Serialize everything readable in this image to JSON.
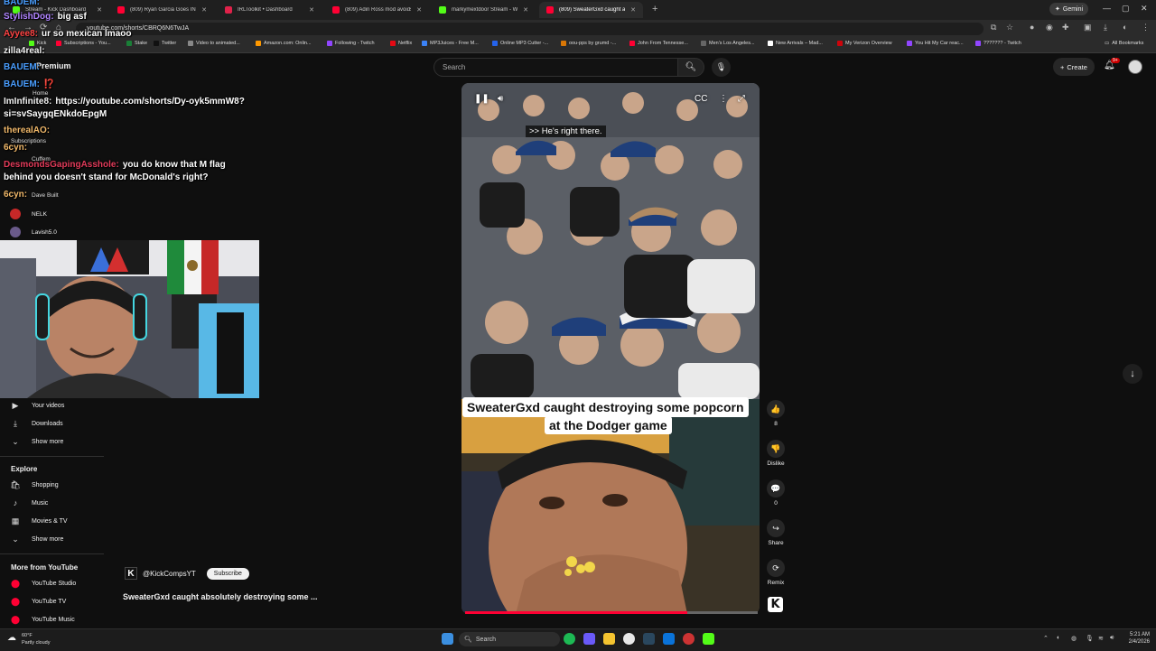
{
  "browser": {
    "tabs": [
      {
        "label": "Stream - Kick Dashboard",
        "color": "#53fc18"
      },
      {
        "label": "(809) Ryan Garcia Goes INSANE",
        "color": "#ff0033"
      },
      {
        "label": "IRLToolkit • Dashboard",
        "color": "#e0224a"
      },
      {
        "label": "(809) Adin Ross mod avoids ja...",
        "color": "#ff0033"
      },
      {
        "label": "markymextdoor Stream - Watch",
        "color": "#53fc18"
      },
      {
        "label": "(809) SweaterGxd caught ac...",
        "color": "#ff0033",
        "active": true
      }
    ],
    "gemini_label": "Gemini",
    "url": "youtube.com/shorts/CBRQ6N6TwJA",
    "bookmarks": [
      "Kick",
      "Subscriptions - You...",
      "Stake",
      "Twitter",
      "Video to animated...",
      "Amazon.com: Onlin...",
      "Following - Twitch",
      "Netflix",
      "MP3Juices - Free M...",
      "Online MP3 Cutter -...",
      "oou-pps by grumd -...",
      "John From Tennesse...",
      "Men's Los Angeles...",
      "New Arrivals – Mad...",
      "My Verizon Overview",
      "You Hit My Car reac...",
      "??????? - Twitch"
    ],
    "all_bookmarks": "All Bookmarks"
  },
  "youtube": {
    "search_placeholder": "Search",
    "create_label": "Create",
    "notif_count": "9+",
    "premium_label": "Premium",
    "sidebar": {
      "top_items": [
        "Home",
        "Subscriptions"
      ],
      "subscriptions": [
        "Cuffem",
        "Dave Built",
        "NELK",
        "Lavish5.0"
      ],
      "you_items": [
        "Your videos",
        "Downloads",
        "Show more"
      ],
      "explore_title": "Explore",
      "explore_items": [
        "Shopping",
        "Music",
        "Movies & TV",
        "Show more"
      ],
      "more_title": "More from YouTube",
      "more_items": [
        "YouTube Studio",
        "YouTube TV",
        "YouTube Music"
      ]
    },
    "short": {
      "caption": ">> He's right there.",
      "title_line1": "SweaterGxd caught destroying some popcorn",
      "title_line2": "at the Dodger game",
      "channel": "@KickCompsYT",
      "subscribe_label": "Subscribe",
      "description": "SweaterGxd caught absolutely destroying some ...",
      "progress": 0.76,
      "actions": [
        {
          "icon": "like-icon",
          "glyph": "👍",
          "label": "8"
        },
        {
          "icon": "dislike-icon",
          "glyph": "👎",
          "label": "Dislike"
        },
        {
          "icon": "comment-icon",
          "glyph": "💬",
          "label": "0"
        },
        {
          "icon": "share-icon",
          "glyph": "↪",
          "label": "Share"
        },
        {
          "icon": "remix-icon",
          "glyph": "⟳",
          "label": "Remix"
        }
      ]
    }
  },
  "chat": [
    {
      "name": "BAUEM:",
      "msg": "",
      "color": "#4a9eff"
    },
    {
      "name": "StylishDog:",
      "msg": "big asf",
      "color": "#b084ff"
    },
    {
      "name": "Ayyee8:",
      "msg": "ur so mexican lmaoo",
      "color": "#ff4444"
    },
    {
      "name": "zilla4real:",
      "msg": "",
      "color": "#f1f1f1"
    },
    {
      "name": "BAUEM:",
      "msg": "",
      "color": "#4a9eff"
    },
    {
      "name": "BAUEM:",
      "msg": "⁉️",
      "color": "#4a9eff"
    },
    {
      "name": "ImInfinite8:",
      "msg": "https://youtube.com/shorts/Dy-oyk5mmW8?",
      "color": "#f1f1f1"
    },
    {
      "name": "",
      "msg": "si=svSaygqENkdoEpgM",
      "color": "#f1f1f1"
    },
    {
      "name": "therealAO:",
      "msg": "",
      "color": "#f0b86a"
    },
    {
      "name": "6cyn:",
      "msg": "",
      "color": "#f0b86a"
    },
    {
      "name": "DesmondsGapingAsshole:",
      "msg": "you do know that M flag",
      "color": "#e23b5a"
    },
    {
      "name": "",
      "msg": "behind you doesn't stand for McDonald's right?",
      "color": "#f1f1f1"
    },
    {
      "name": "6cyn:",
      "msg": "",
      "color": "#f0b86a"
    }
  ],
  "taskbar": {
    "weather_temp": "60°F",
    "weather_desc": "Partly cloudy",
    "search_label": "Search",
    "time": "5:21 AM",
    "date": "2/4/2026"
  }
}
